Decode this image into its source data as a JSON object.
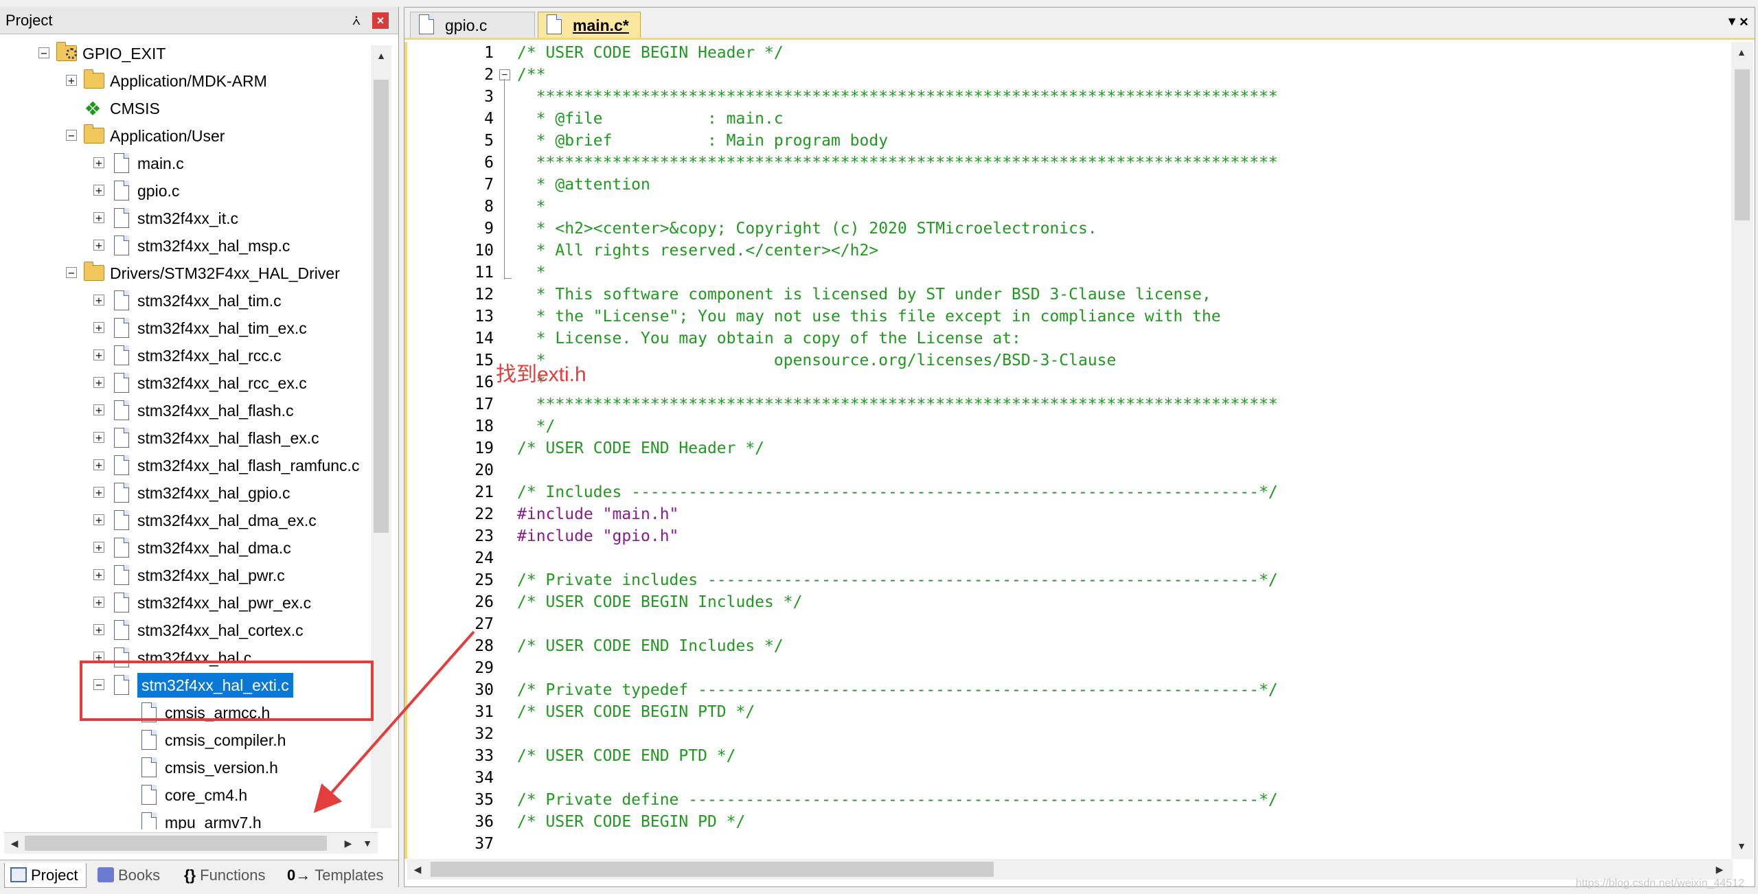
{
  "project": {
    "header_title": "Project",
    "pin_glyph": "⩑",
    "close_glyph": "×",
    "root": "GPIO_EXIT",
    "tree": [
      {
        "label": "GPIO_EXIT",
        "level": 0,
        "icon": "gear-folder-icon",
        "expander": "−"
      },
      {
        "label": "Application/MDK-ARM",
        "level": 1,
        "icon": "folder-icon",
        "expander": "+"
      },
      {
        "label": "CMSIS",
        "level": 1,
        "icon": "cmsis-icon",
        "expander": ""
      },
      {
        "label": "Application/User",
        "level": 1,
        "icon": "folder-open-icon",
        "expander": "−"
      },
      {
        "label": "main.c",
        "level": 2,
        "icon": "file-icon",
        "expander": "+"
      },
      {
        "label": "gpio.c",
        "level": 2,
        "icon": "file-icon",
        "expander": "+"
      },
      {
        "label": "stm32f4xx_it.c",
        "level": 2,
        "icon": "file-icon",
        "expander": "+"
      },
      {
        "label": "stm32f4xx_hal_msp.c",
        "level": 2,
        "icon": "file-icon",
        "expander": "+"
      },
      {
        "label": "Drivers/STM32F4xx_HAL_Driver",
        "level": 1,
        "icon": "folder-open-icon",
        "expander": "−"
      },
      {
        "label": "stm32f4xx_hal_tim.c",
        "level": 2,
        "icon": "file-icon",
        "expander": "+"
      },
      {
        "label": "stm32f4xx_hal_tim_ex.c",
        "level": 2,
        "icon": "file-icon",
        "expander": "+"
      },
      {
        "label": "stm32f4xx_hal_rcc.c",
        "level": 2,
        "icon": "file-icon",
        "expander": "+"
      },
      {
        "label": "stm32f4xx_hal_rcc_ex.c",
        "level": 2,
        "icon": "file-icon",
        "expander": "+"
      },
      {
        "label": "stm32f4xx_hal_flash.c",
        "level": 2,
        "icon": "file-icon",
        "expander": "+"
      },
      {
        "label": "stm32f4xx_hal_flash_ex.c",
        "level": 2,
        "icon": "file-icon",
        "expander": "+"
      },
      {
        "label": "stm32f4xx_hal_flash_ramfunc.c",
        "level": 2,
        "icon": "file-icon",
        "expander": "+"
      },
      {
        "label": "stm32f4xx_hal_gpio.c",
        "level": 2,
        "icon": "file-icon",
        "expander": "+"
      },
      {
        "label": "stm32f4xx_hal_dma_ex.c",
        "level": 2,
        "icon": "file-icon",
        "expander": "+"
      },
      {
        "label": "stm32f4xx_hal_dma.c",
        "level": 2,
        "icon": "file-icon",
        "expander": "+"
      },
      {
        "label": "stm32f4xx_hal_pwr.c",
        "level": 2,
        "icon": "file-icon",
        "expander": "+"
      },
      {
        "label": "stm32f4xx_hal_pwr_ex.c",
        "level": 2,
        "icon": "file-icon",
        "expander": "+"
      },
      {
        "label": "stm32f4xx_hal_cortex.c",
        "level": 2,
        "icon": "file-icon",
        "expander": "+"
      },
      {
        "label": "stm32f4xx_hal.c",
        "level": 2,
        "icon": "file-icon",
        "expander": "+"
      },
      {
        "label": "stm32f4xx_hal_exti.c",
        "level": 2,
        "icon": "file-icon",
        "expander": "−",
        "selected": true
      },
      {
        "label": "cmsis_armcc.h",
        "level": 3,
        "icon": "file-icon",
        "expander": ""
      },
      {
        "label": "cmsis_compiler.h",
        "level": 3,
        "icon": "file-icon",
        "expander": ""
      },
      {
        "label": "cmsis_version.h",
        "level": 3,
        "icon": "file-icon",
        "expander": ""
      },
      {
        "label": "core_cm4.h",
        "level": 3,
        "icon": "file-icon",
        "expander": ""
      },
      {
        "label": "mpu_armv7.h",
        "level": 3,
        "icon": "file-icon",
        "expander": ""
      }
    ],
    "bottom_tabs": [
      {
        "label": "Project",
        "icon": "project-icon",
        "active": true
      },
      {
        "label": "Books",
        "icon": "books-icon",
        "active": false
      },
      {
        "label": "Functions",
        "icon": "functions-icon",
        "active": false,
        "glyph": "{}"
      },
      {
        "label": "Templates",
        "icon": "templates-icon",
        "active": false,
        "glyph": "0→"
      }
    ]
  },
  "editor": {
    "tabs": [
      {
        "label": "gpio.c",
        "active": false
      },
      {
        "label": "main.c*",
        "active": true
      }
    ],
    "dropdown_glyph": "▼",
    "close_glyph": "×",
    "annotation": "找到exti.h",
    "lines": [
      {
        "n": "1",
        "t": "/* USER CODE BEGIN Header */",
        "k": "comment"
      },
      {
        "n": "2",
        "t": "/**",
        "k": "comment",
        "fold": "−"
      },
      {
        "n": "3",
        "t": "  ******************************************************************************",
        "k": "comment"
      },
      {
        "n": "4",
        "t": "  * @file           : main.c",
        "k": "comment"
      },
      {
        "n": "5",
        "t": "  * @brief          : Main program body",
        "k": "comment"
      },
      {
        "n": "6",
        "t": "  ******************************************************************************",
        "k": "comment"
      },
      {
        "n": "7",
        "t": "  * @attention",
        "k": "comment"
      },
      {
        "n": "8",
        "t": "  *",
        "k": "comment"
      },
      {
        "n": "9",
        "t": "  * <h2><center>&copy; Copyright (c) 2020 STMicroelectronics.",
        "k": "comment"
      },
      {
        "n": "10",
        "t": "  * All rights reserved.</center></h2>",
        "k": "comment"
      },
      {
        "n": "11",
        "t": "  *",
        "k": "comment"
      },
      {
        "n": "12",
        "t": "  * This software component is licensed by ST under BSD 3-Clause license,",
        "k": "comment"
      },
      {
        "n": "13",
        "t": "  * the \"License\"; You may not use this file except in compliance with the",
        "k": "comment"
      },
      {
        "n": "14",
        "t": "  * License. You may obtain a copy of the License at:",
        "k": "comment"
      },
      {
        "n": "15",
        "t": "  *                        opensource.org/licenses/BSD-3-Clause",
        "k": "comment"
      },
      {
        "n": "16",
        "t": "  *",
        "k": "comment"
      },
      {
        "n": "17",
        "t": "  ******************************************************************************",
        "k": "comment"
      },
      {
        "n": "18",
        "t": "  */",
        "k": "comment"
      },
      {
        "n": "19",
        "t": "/* USER CODE END Header */",
        "k": "comment"
      },
      {
        "n": "20",
        "t": "",
        "k": "plain"
      },
      {
        "n": "21",
        "t": "/* Includes ------------------------------------------------------------------*/",
        "k": "comment"
      },
      {
        "n": "22",
        "t": "#include",
        "k": "include",
        "s": " \"main.h\""
      },
      {
        "n": "23",
        "t": "#include",
        "k": "include",
        "s": " \"gpio.h\""
      },
      {
        "n": "24",
        "t": "",
        "k": "plain"
      },
      {
        "n": "25",
        "t": "/* Private includes ----------------------------------------------------------*/",
        "k": "comment"
      },
      {
        "n": "26",
        "t": "/* USER CODE BEGIN Includes */",
        "k": "comment"
      },
      {
        "n": "27",
        "t": "",
        "k": "plain"
      },
      {
        "n": "28",
        "t": "/* USER CODE END Includes */",
        "k": "comment"
      },
      {
        "n": "29",
        "t": "",
        "k": "plain"
      },
      {
        "n": "30",
        "t": "/* Private typedef -----------------------------------------------------------*/",
        "k": "comment"
      },
      {
        "n": "31",
        "t": "/* USER CODE BEGIN PTD */",
        "k": "comment"
      },
      {
        "n": "32",
        "t": "",
        "k": "plain"
      },
      {
        "n": "33",
        "t": "/* USER CODE END PTD */",
        "k": "comment"
      },
      {
        "n": "34",
        "t": "",
        "k": "plain"
      },
      {
        "n": "35",
        "t": "/* Private define ------------------------------------------------------------*/",
        "k": "comment"
      },
      {
        "n": "36",
        "t": "/* USER CODE BEGIN PD */",
        "k": "comment"
      },
      {
        "n": "37",
        "t": "",
        "k": "plain"
      }
    ]
  },
  "watermark": "https://blog.csdn.net/weixin_44512"
}
